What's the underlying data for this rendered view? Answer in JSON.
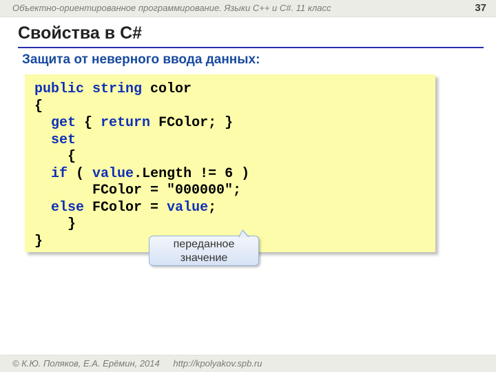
{
  "header": {
    "course": "Объектно-ориентированное программирование. Языки C++ и C#. 11 класс",
    "page": "37"
  },
  "title": "Свойства в C#",
  "subhead": "Защита от неверного ввода данных:",
  "code": {
    "l1_public": "public",
    "l1_string": "string",
    "l1_rest": " color",
    "l2": "{",
    "l3_get": "get",
    "l3_mid1": " { ",
    "l3_return": "return",
    "l3_mid2": " FColor; }",
    "l4_set": "set",
    "l5": "  {",
    "l6_if": "if",
    "l6_mid1": " ( ",
    "l6_value": "value",
    "l6_mid2": ".Length != 6 )",
    "l7": "       FColor = \"000000\";",
    "l8_else": "else",
    "l8_mid1": " FColor = ",
    "l8_value": "value",
    "l8_mid2": ";",
    "l9": "  }",
    "l10": "}"
  },
  "callout": {
    "line1": "переданное",
    "line2": "значение"
  },
  "footer": {
    "copyright": "© К.Ю. Поляков, Е.А. Ерёмин, 2014",
    "url": "http://kpolyakov.spb.ru"
  }
}
